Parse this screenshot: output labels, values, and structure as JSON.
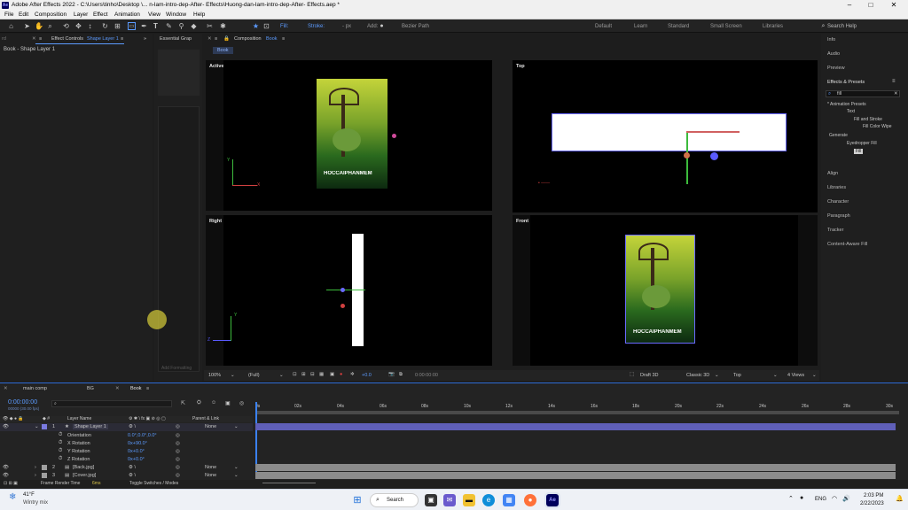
{
  "window": {
    "app_icon": "Ae",
    "title": "Adobe After Effects 2022 - C:\\Users\\tinho\\Desktop \\... n-lam-intro-dep-After- Effects\\Huong-dan-lam-intro-dep-After- Effects.aep *"
  },
  "menu": [
    "File",
    "Edit",
    "Composition",
    "Layer",
    "Effect",
    "Animation",
    "View",
    "Window",
    "Help"
  ],
  "toolbar": {
    "fill_label": "Fill:",
    "stroke_label": "Stroke:",
    "stroke_px": "-  px",
    "add_label": "Add:",
    "bezier_label": "Bezier Path",
    "workspaces": [
      "Default",
      "Learn",
      "Standard",
      "Small Screen",
      "Libraries"
    ],
    "search_placeholder": "Search Help"
  },
  "left_panel": {
    "tab_label": "Effect Controls",
    "tab_target": "Shape Layer 1",
    "breadcrumb": "Book - Shape Layer 1",
    "essential_tab": "Essential Grap",
    "add_formatting": "Add Formatting"
  },
  "composition": {
    "tab_label": "Composition",
    "tab_name": "Book",
    "chip": "Book",
    "views": {
      "active_camera": "Active Camera (Default)",
      "top": "Top",
      "right": "Right",
      "front": "Front"
    },
    "poster_title": "HOCCAIPHANMEM",
    "zoom": "100%",
    "resolution": "(Full)",
    "exposure": "+0.0",
    "timecode": "0:00:00:00",
    "renderer": "Draft 3D",
    "renderer_mode": "Classic 3D",
    "view_select": "Top",
    "layout": "4 Views"
  },
  "right_panel": {
    "items_top": [
      "Info",
      "Audio",
      "Preview"
    ],
    "effects_title": "Effects & Presets",
    "search_value": "fill",
    "tree": [
      {
        "label": "* Animation Presets",
        "indent": 0
      },
      {
        "label": "Text",
        "indent": 1
      },
      {
        "label": "Fill and Stroke",
        "indent": 2
      },
      {
        "label": "Fill Color Wipe",
        "indent": 3
      },
      {
        "label": "Generate",
        "indent": 0
      },
      {
        "label": "Eyedropper Fill",
        "indent": 1
      },
      {
        "label": "Fill",
        "indent": 1
      }
    ],
    "items_bottom": [
      "Align",
      "Libraries",
      "Character",
      "Paragraph",
      "Tracker",
      "Content-Aware Fill"
    ]
  },
  "timeline": {
    "tabs": [
      "main comp",
      "BG",
      "Book"
    ],
    "timecode": "0:00:00:00",
    "frame_info": "00000 (30.00 fps)",
    "header_layer_name": "Layer Name",
    "header_parent": "Parent & Link",
    "ruler": [
      "0s",
      "02s",
      "04s",
      "06s",
      "08s",
      "10s",
      "12s",
      "14s",
      "16s",
      "18s",
      "20s",
      "22s",
      "24s",
      "26s",
      "28s",
      "30s"
    ],
    "layers": [
      {
        "num": "1",
        "name": "Shape Layer 1",
        "parent": "None",
        "color": "#7a7ae0"
      },
      {
        "num": "2",
        "name": "[Back.jpg]",
        "parent": "None",
        "color": "#a0a0a0"
      },
      {
        "num": "3",
        "name": "[Cover.jpg]",
        "parent": "None",
        "color": "#a0a0a0"
      }
    ],
    "props": [
      {
        "name": "Orientation",
        "value": "0.0°,0.0°,0.0°"
      },
      {
        "name": "X Rotation",
        "value": "0x+90.0°"
      },
      {
        "name": "Y Rotation",
        "value": "0x+0.0°"
      },
      {
        "name": "Z Rotation",
        "value": "0x+0.0°"
      }
    ],
    "render_label": "Frame Render Time",
    "render_value": "6ms",
    "toggle_label": "Toggle Switches / Modes"
  },
  "taskbar": {
    "temp": "41°F",
    "weather": "Wintry mix",
    "search_label": "Search",
    "lang": "ENG",
    "time": "2:03 PM",
    "date": "2/22/2023"
  }
}
